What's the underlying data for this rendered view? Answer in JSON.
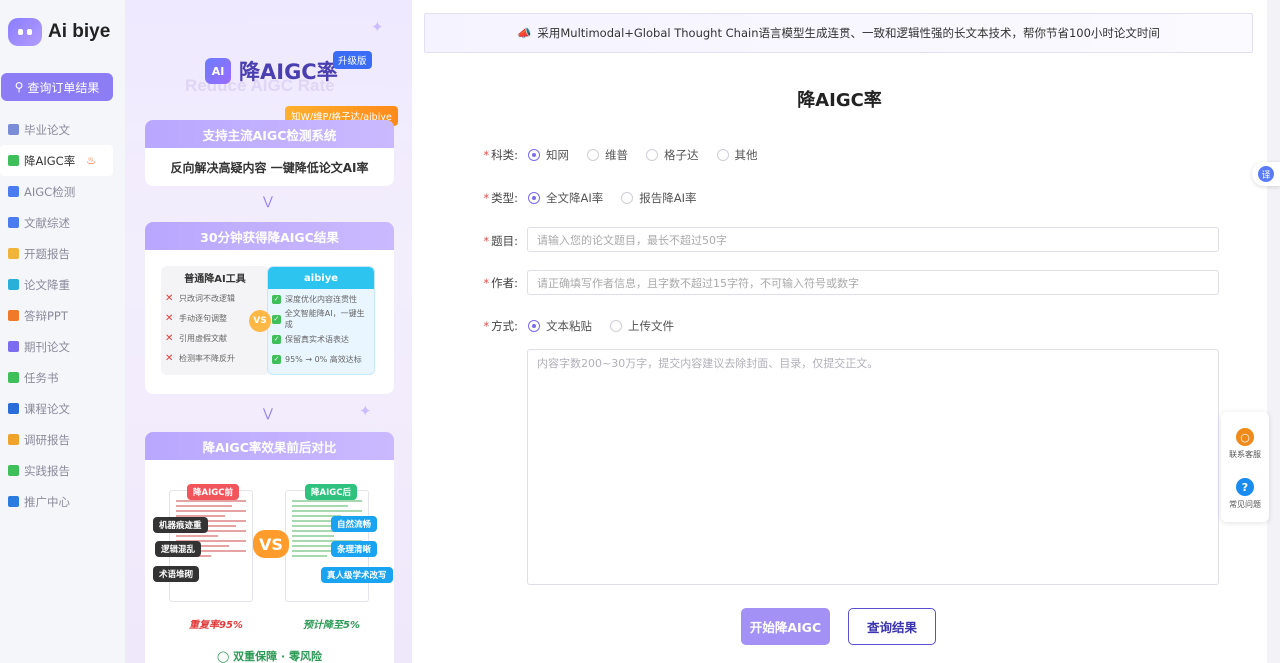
{
  "brand": {
    "name": "Ai biye"
  },
  "sidebar": {
    "query_button": "查询订单结果",
    "items": [
      {
        "label": "毕业论文",
        "icon": "graduation-cap-icon",
        "color": "#7b8dd6"
      },
      {
        "label": "降AIGC率",
        "icon": "ai-icon",
        "color": "#3fbf5a",
        "active": true
      },
      {
        "label": "AIGC检测",
        "icon": "aigc-detect-icon",
        "color": "#4a7cf0"
      },
      {
        "label": "文献综述",
        "icon": "document-icon",
        "color": "#4a7cf0"
      },
      {
        "label": "开题报告",
        "icon": "report-icon",
        "color": "#f0b43a"
      },
      {
        "label": "论文降重",
        "icon": "chart-icon",
        "color": "#2ab0d8"
      },
      {
        "label": "答辩PPT",
        "icon": "ppt-icon",
        "color": "#f07a2a"
      },
      {
        "label": "期刊论文",
        "icon": "journal-icon",
        "color": "#7b6cf0"
      },
      {
        "label": "任务书",
        "icon": "task-icon",
        "color": "#3fbf5a"
      },
      {
        "label": "课程论文",
        "icon": "book-icon",
        "color": "#2a6cd8"
      },
      {
        "label": "调研报告",
        "icon": "survey-icon",
        "color": "#f0a32a"
      },
      {
        "label": "实践报告",
        "icon": "practice-icon",
        "color": "#3fbf5a"
      },
      {
        "label": "推广中心",
        "icon": "send-icon",
        "color": "#2a7ce0"
      }
    ]
  },
  "promo": {
    "title": "降AIGC率",
    "ai_badge": "AI",
    "upgrade": "升级版",
    "watermark": "Reduce AIGC Rate",
    "tag": "知W/维P/格子达/aibiye",
    "card1_head": "支持主流AIGC检测系统",
    "card1_body": "反向解决高疑内容 一键降低论文AI率",
    "card2_head": "30分钟获得降AIGC结果",
    "left_title": "普通降AI工具",
    "left_rows": [
      "只改词不改逻辑",
      "手动逐句调整",
      "引用虚假文献",
      "检测率不降反升"
    ],
    "right_title": "aibiye",
    "right_rows": [
      "深度优化内容连贯性",
      "全文智能降AI，一键生成",
      "保留真实术语表达",
      "95% → 0% 高效达标"
    ],
    "vs": "VS",
    "card3_head": "降AIGC率效果前后对比",
    "before_label": "降AIGC前",
    "after_label": "降AIGC后",
    "before_tags": [
      "机器痕迹重",
      "逻辑混乱",
      "术语堆砌"
    ],
    "after_tags": [
      "自然流畅",
      "条理清晰",
      "真人级学术改写"
    ],
    "before_stat": "重复率95%",
    "after_stat": "预计降至5%",
    "guarantee": "双重保障 · 零风险"
  },
  "main": {
    "banner": "采用Multimodal+Global Thought Chain语言模型生成连贯、一致和逻辑性强的长文本技术，帮你节省100小时论文时间",
    "title": "降AIGC率",
    "subject_label": "科类:",
    "subjects": [
      "知网",
      "维普",
      "格子达",
      "其他"
    ],
    "type_label": "类型:",
    "types": [
      "全文降AI率",
      "报告降AI率"
    ],
    "title_label": "题目:",
    "title_placeholder": "请输入您的论文题目，最长不超过50字",
    "author_label": "作者:",
    "author_placeholder": "请正确填写作者信息，且字数不超过15字符，不可输入符号或数字",
    "method_label": "方式:",
    "methods": [
      "文本粘贴",
      "上传文件"
    ],
    "content_placeholder": "内容字数200~30万字，提交内容建议去除封面、目录，仅提交正文。",
    "start_button": "开始降AIGC",
    "query_button": "查询结果"
  },
  "floaters": {
    "translate": "译",
    "service": "联系客服",
    "faq": "常见问题"
  }
}
